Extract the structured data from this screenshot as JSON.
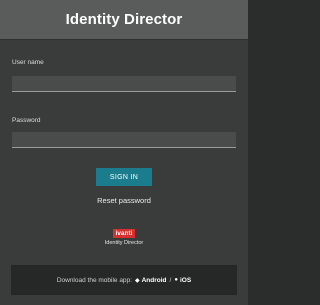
{
  "header": {
    "title": "Identity Director"
  },
  "form": {
    "username_label": "User name",
    "username_value": "",
    "password_label": "Password",
    "password_value": "",
    "signin_label": "SIGN IN",
    "reset_label": "Reset password"
  },
  "branding": {
    "logo_text": "ivanti",
    "product_name": "Identity Director",
    "brand_color": "#d62f2f"
  },
  "footer": {
    "prefix": "Download the mobile app:",
    "android_icon": "android-icon",
    "android_label": "Android",
    "separator": "/",
    "ios_icon": "apple-icon",
    "ios_label": "iOS"
  },
  "colors": {
    "header_bg": "#5a5c5b",
    "card_bg": "#3a3c3b",
    "button_bg": "#1a7c8c",
    "footer_bg": "#262827"
  }
}
